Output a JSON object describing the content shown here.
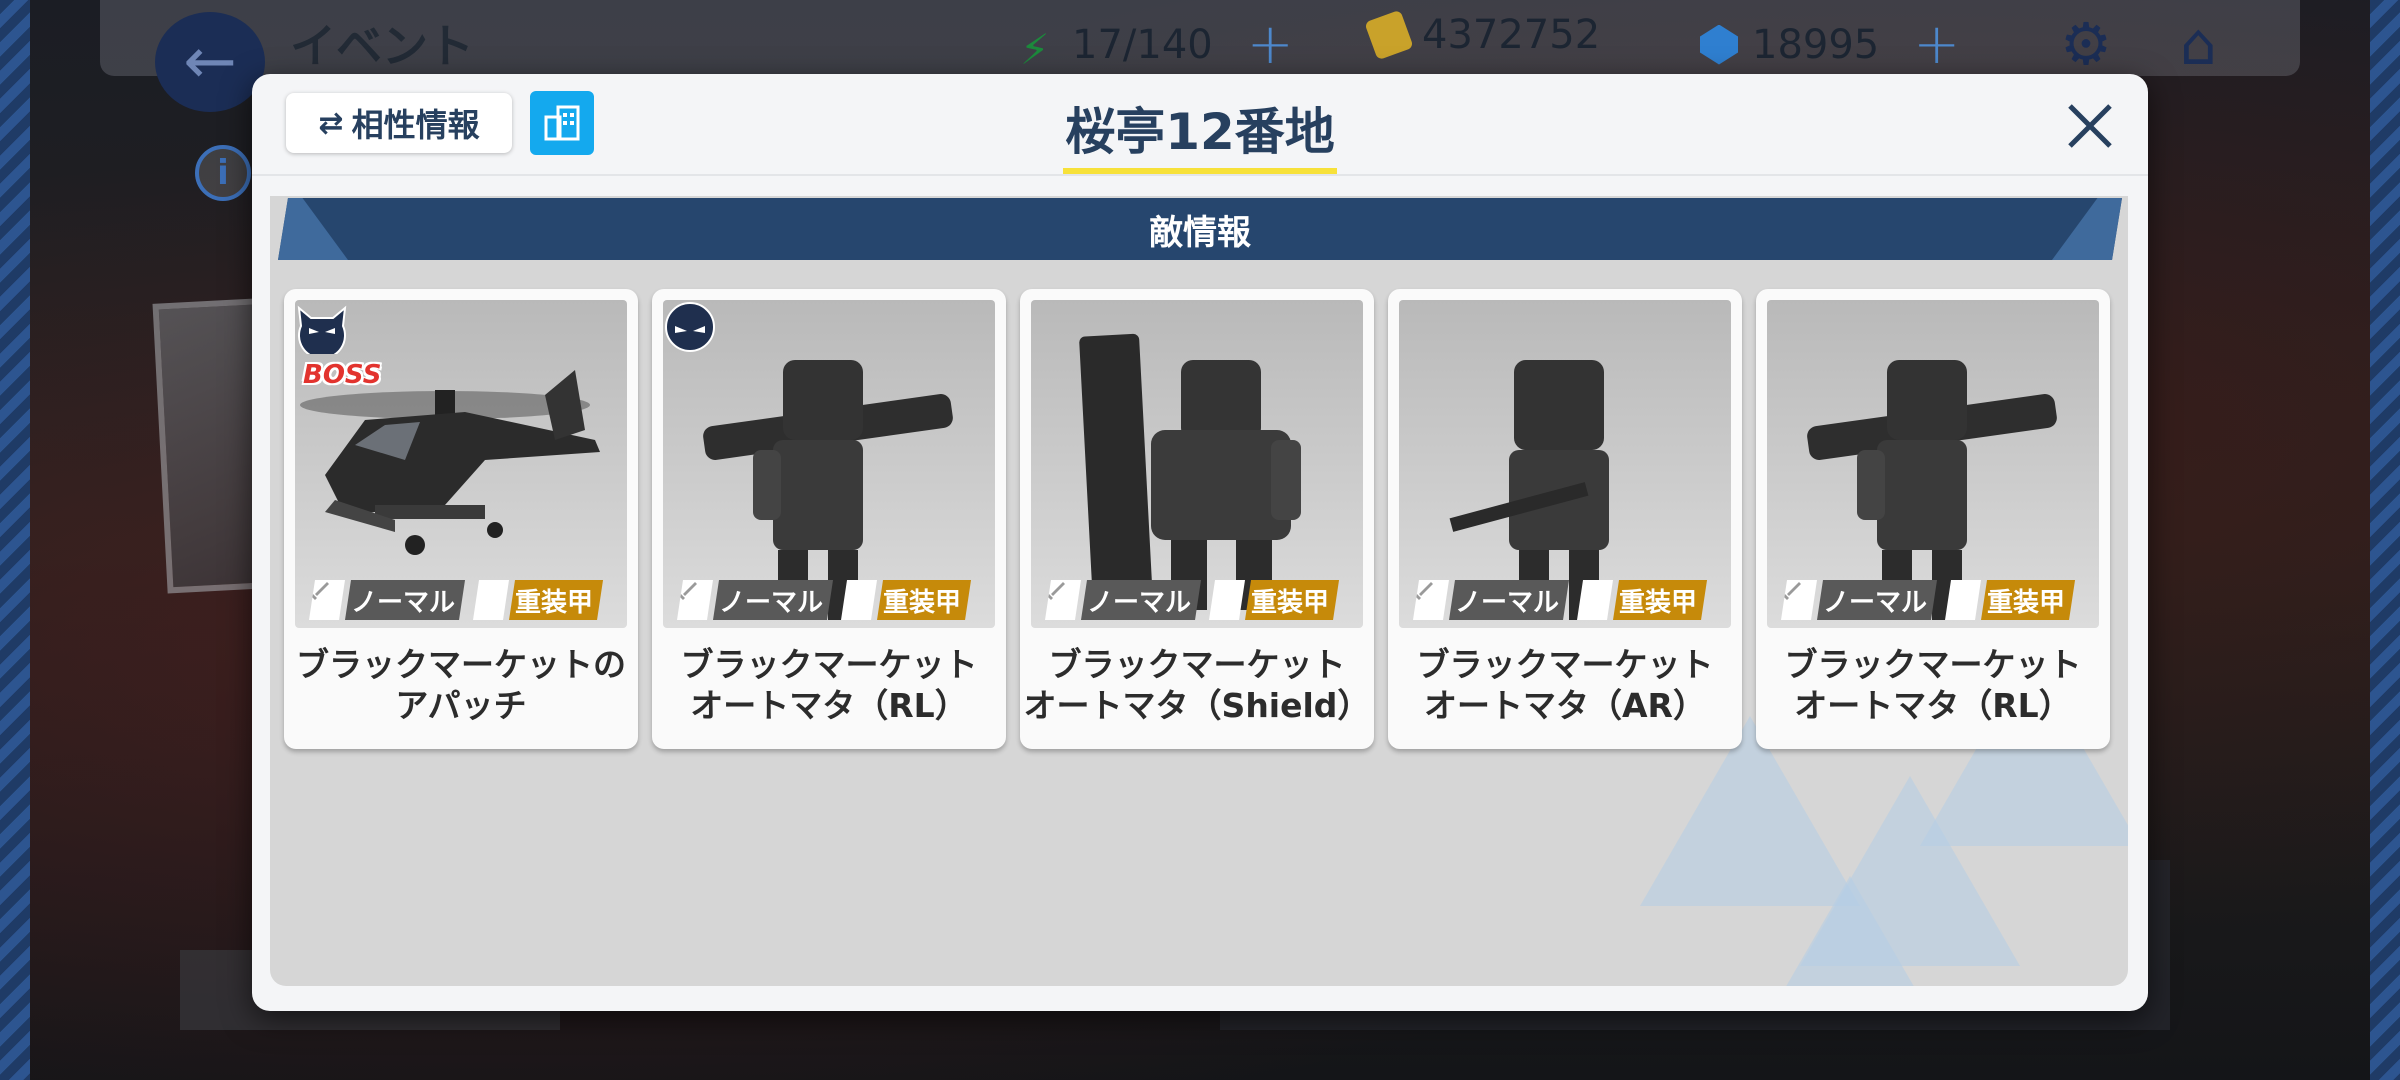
{
  "topbar": {
    "title": "イベント",
    "energy": "17/140",
    "credits": "4372752",
    "gems": "18995"
  },
  "dialog": {
    "title": "桜亭12番地",
    "affinity_label": "相性情報",
    "section_title": "敵情報"
  },
  "enemies": [
    {
      "name": "ブラックマーケットの\nアパッチ",
      "attack": "ノーマル",
      "armor": "重装甲",
      "boss": true,
      "boss_label": "BOSS"
    },
    {
      "name": "ブラックマーケット\nオートマタ（RL）",
      "attack": "ノーマル",
      "armor": "重装甲",
      "boss": false
    },
    {
      "name": "ブラックマーケット\nオートマタ（Shield）",
      "attack": "ノーマル",
      "armor": "重装甲",
      "boss": false
    },
    {
      "name": "ブラックマーケット\nオートマタ（AR）",
      "attack": "ノーマル",
      "armor": "重装甲",
      "boss": false
    },
    {
      "name": "ブラックマーケット\nオートマタ（RL）",
      "attack": "ノーマル",
      "armor": "重装甲",
      "boss": false
    }
  ],
  "colors": {
    "banner": "#26466e",
    "attack_tag": "#595959",
    "armor_tag": "#c68a0a",
    "title_underline": "#f7e13a",
    "building_button": "#14a9ee"
  },
  "icons": [
    "back-arrow-icon",
    "energy-icon",
    "credit-icon",
    "gem-icon",
    "plus-icon",
    "gear-icon",
    "home-icon",
    "info-icon",
    "affinity-icon",
    "building-icon",
    "close-icon",
    "enemy-icon",
    "boss-icon",
    "sword-icon",
    "shield-icon"
  ]
}
